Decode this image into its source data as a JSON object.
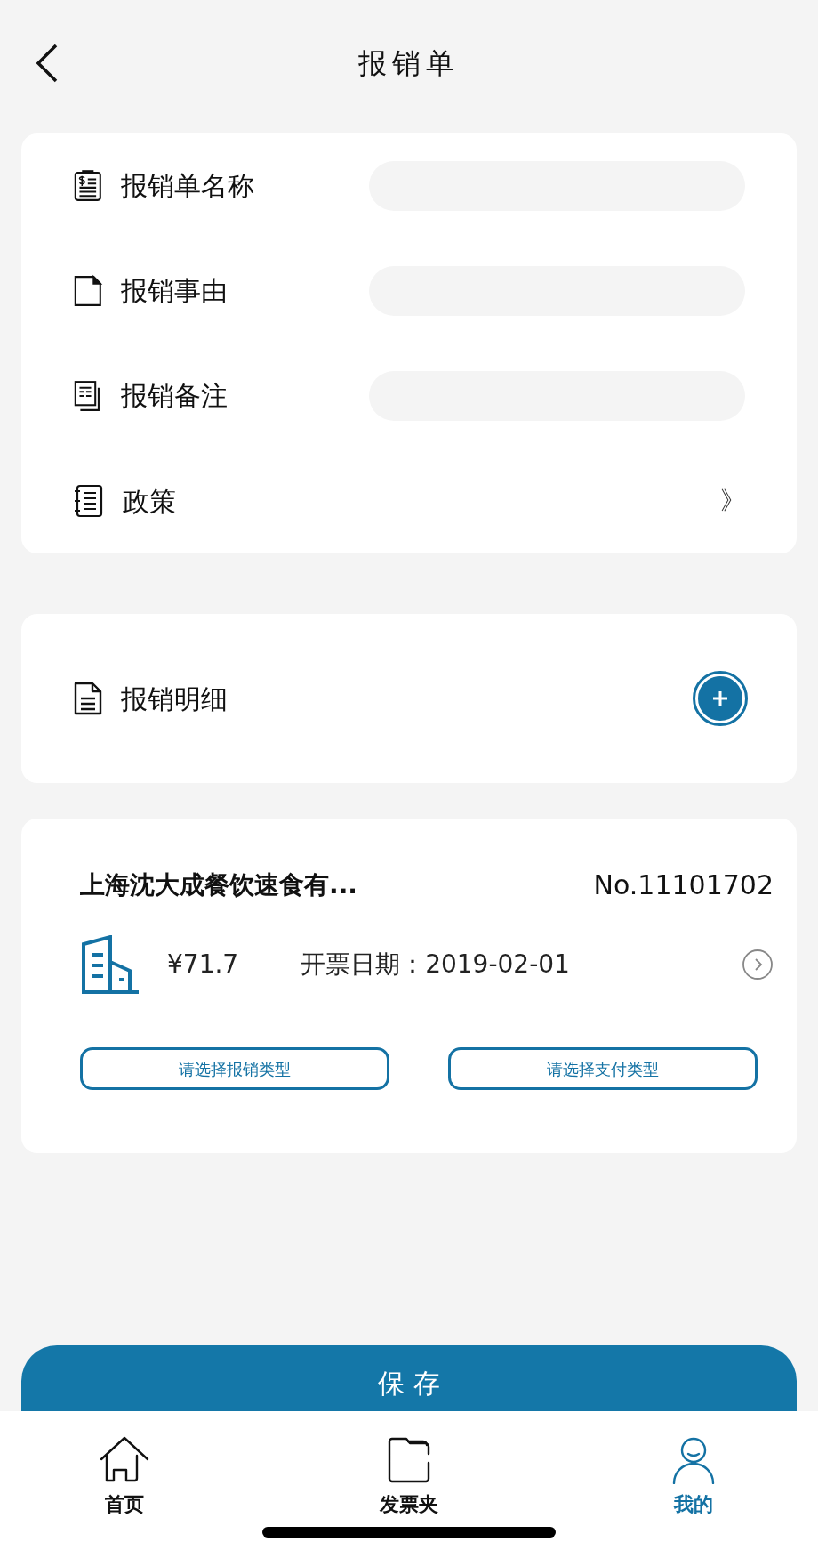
{
  "header": {
    "title": "报销单"
  },
  "form_rows": [
    {
      "kind": "input",
      "label": "报销单名称"
    },
    {
      "kind": "input",
      "label": "报销事由"
    },
    {
      "kind": "input",
      "label": "报销备注"
    },
    {
      "kind": "link",
      "label": "政策",
      "arrow": "》"
    }
  ],
  "details": {
    "label": "报销明细"
  },
  "invoice": {
    "company": "上海沈大成餐饮速食有...",
    "number": "No.11101702",
    "amount": "¥71.7",
    "date_label": "开票日期：",
    "date": "2019-02-01",
    "buttons": [
      "请选择报销类型",
      "请选择支付类型"
    ]
  },
  "save_button": "保 存",
  "tab_bar": [
    {
      "label": "首页",
      "selected": false
    },
    {
      "label": "发票夹",
      "selected": false
    },
    {
      "label": "我的",
      "selected": true
    }
  ]
}
